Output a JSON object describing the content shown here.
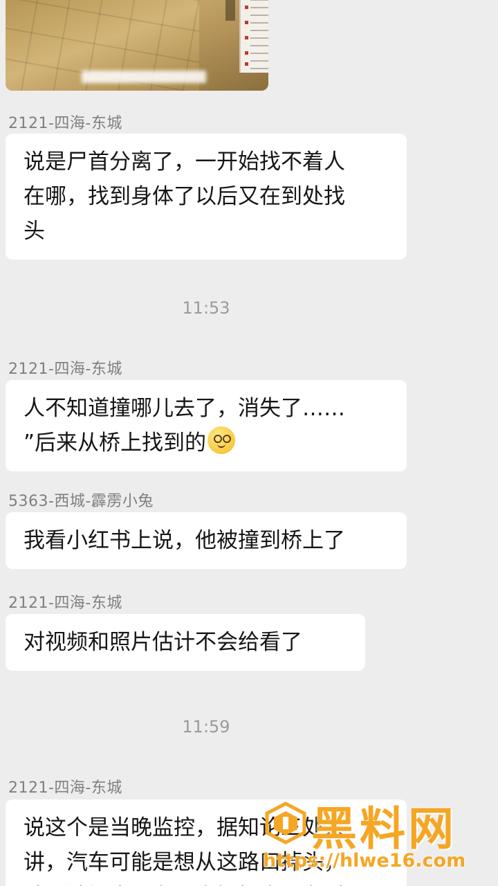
{
  "messages": [
    {
      "sender": "2121-四海-东城",
      "lines": [
        "说是尸首分离了，一开始找不着人",
        "在哪，找到身体了以后又在到处找",
        "头"
      ]
    },
    {
      "time": "11:53"
    },
    {
      "sender": "2121-四海-东城",
      "lines": [
        "人不知道撞哪儿去了，消失了……",
        "”后来从桥上找到的"
      ]
    },
    {
      "sender": "5363-西城-霹雳小兔",
      "lines": [
        "我看小红书上说，他被撞到桥上了"
      ]
    },
    {
      "sender": "2121-四海-东城",
      "lines": [
        "对视频和照片估计不会给看了"
      ]
    },
    {
      "time": "11:59"
    },
    {
      "sender": "2121-四海-东城",
      "lines": [
        "说这个是当晚监控，据知论三处人",
        "讲，汽车可能是想从这路口掉头，",
        "结果被闯当到车，直接把电瓶车对"
      ]
    }
  ],
  "emoji": "grimacing-face-emoji",
  "watermark": {
    "title": "黑料网",
    "url": "https://hlwe16.com",
    "color": "#f5a623"
  },
  "colors": {
    "background": "#ededed",
    "bubble": "#ffffff",
    "sender_text": "#7f7f7f",
    "time_text": "#9a9a9a"
  }
}
